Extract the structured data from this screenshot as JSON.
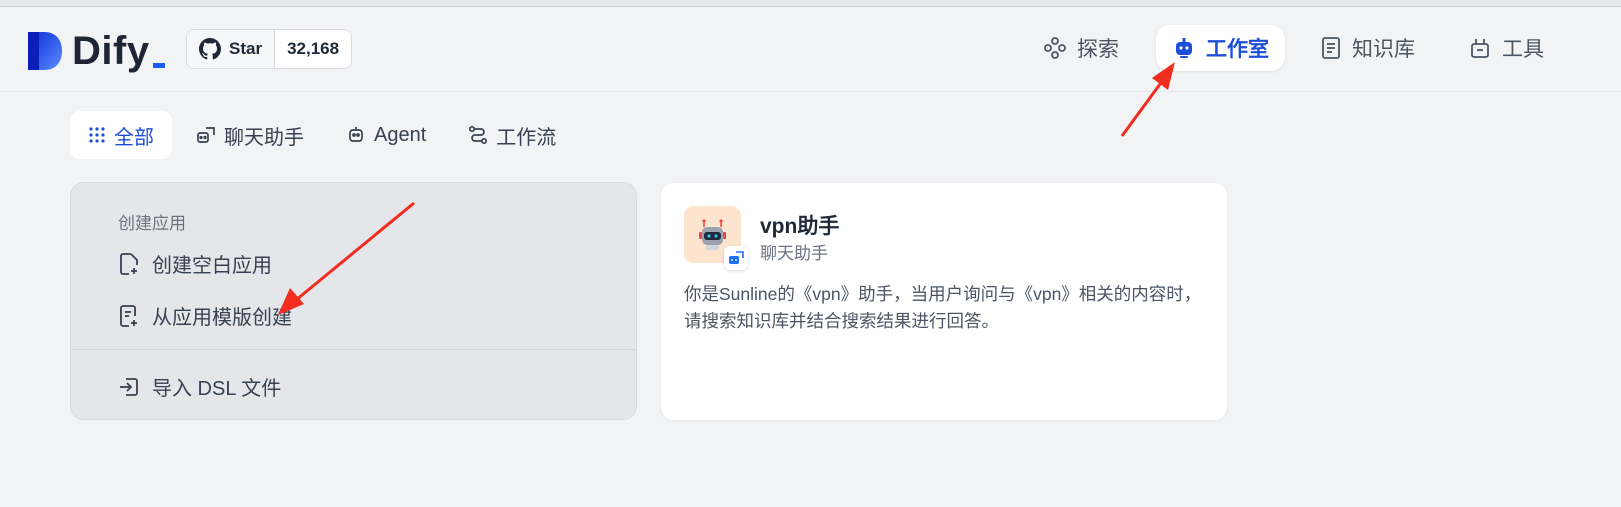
{
  "brand": {
    "name": "Dify",
    "colors": {
      "accent": "#1d4ed8",
      "logo_blue": "#1b5cff",
      "annotation_arrow": "#f02d1e"
    }
  },
  "github": {
    "label": "Star",
    "count": "32,168",
    "icon": "github-icon"
  },
  "nav": {
    "explore": {
      "label": "探索",
      "icon": "explore-icon"
    },
    "studio": {
      "label": "工作室",
      "icon": "robot-icon",
      "active": true
    },
    "knowledge": {
      "label": "知识库",
      "icon": "book-icon"
    },
    "tools": {
      "label": "工具",
      "icon": "tools-icon"
    }
  },
  "tabs": [
    {
      "label": "全部",
      "icon": "grid-icon",
      "active": true
    },
    {
      "label": "聊天助手",
      "icon": "chat-icon"
    },
    {
      "label": "Agent",
      "icon": "agent-icon"
    },
    {
      "label": "工作流",
      "icon": "workflow-icon"
    }
  ],
  "create": {
    "title": "创建应用",
    "blank": "创建空白应用",
    "template": "从应用模版创建",
    "import": "导入 DSL 文件"
  },
  "apps": [
    {
      "name": "vpn助手",
      "type": "聊天助手",
      "description": "你是Sunline的《vpn》助手，当用户询问与《vpn》相关的内容时，请搜索知识库并结合搜索结果进行回答。"
    }
  ]
}
